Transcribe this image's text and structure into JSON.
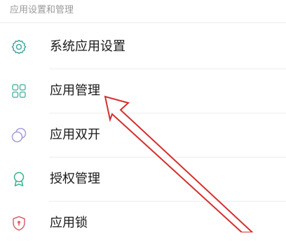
{
  "section": {
    "header": "应用设置和管理"
  },
  "items": [
    {
      "label": "系统应用设置",
      "icon": "gear-icon"
    },
    {
      "label": "应用管理",
      "icon": "grid-icon"
    },
    {
      "label": "应用双开",
      "icon": "dual-app-icon"
    },
    {
      "label": "授权管理",
      "icon": "award-icon"
    },
    {
      "label": "应用锁",
      "icon": "shield-lock-icon"
    }
  ],
  "colors": {
    "icon_gear": "#4aa8a0",
    "icon_grid": "#5ab8a8",
    "icon_dual": "#a99be0",
    "icon_award": "#2fb38f",
    "icon_lock": "#e06070",
    "annotation_arrow": "#d4302e",
    "text_primary": "#1a1a1a",
    "text_secondary": "#9a9a9a"
  }
}
